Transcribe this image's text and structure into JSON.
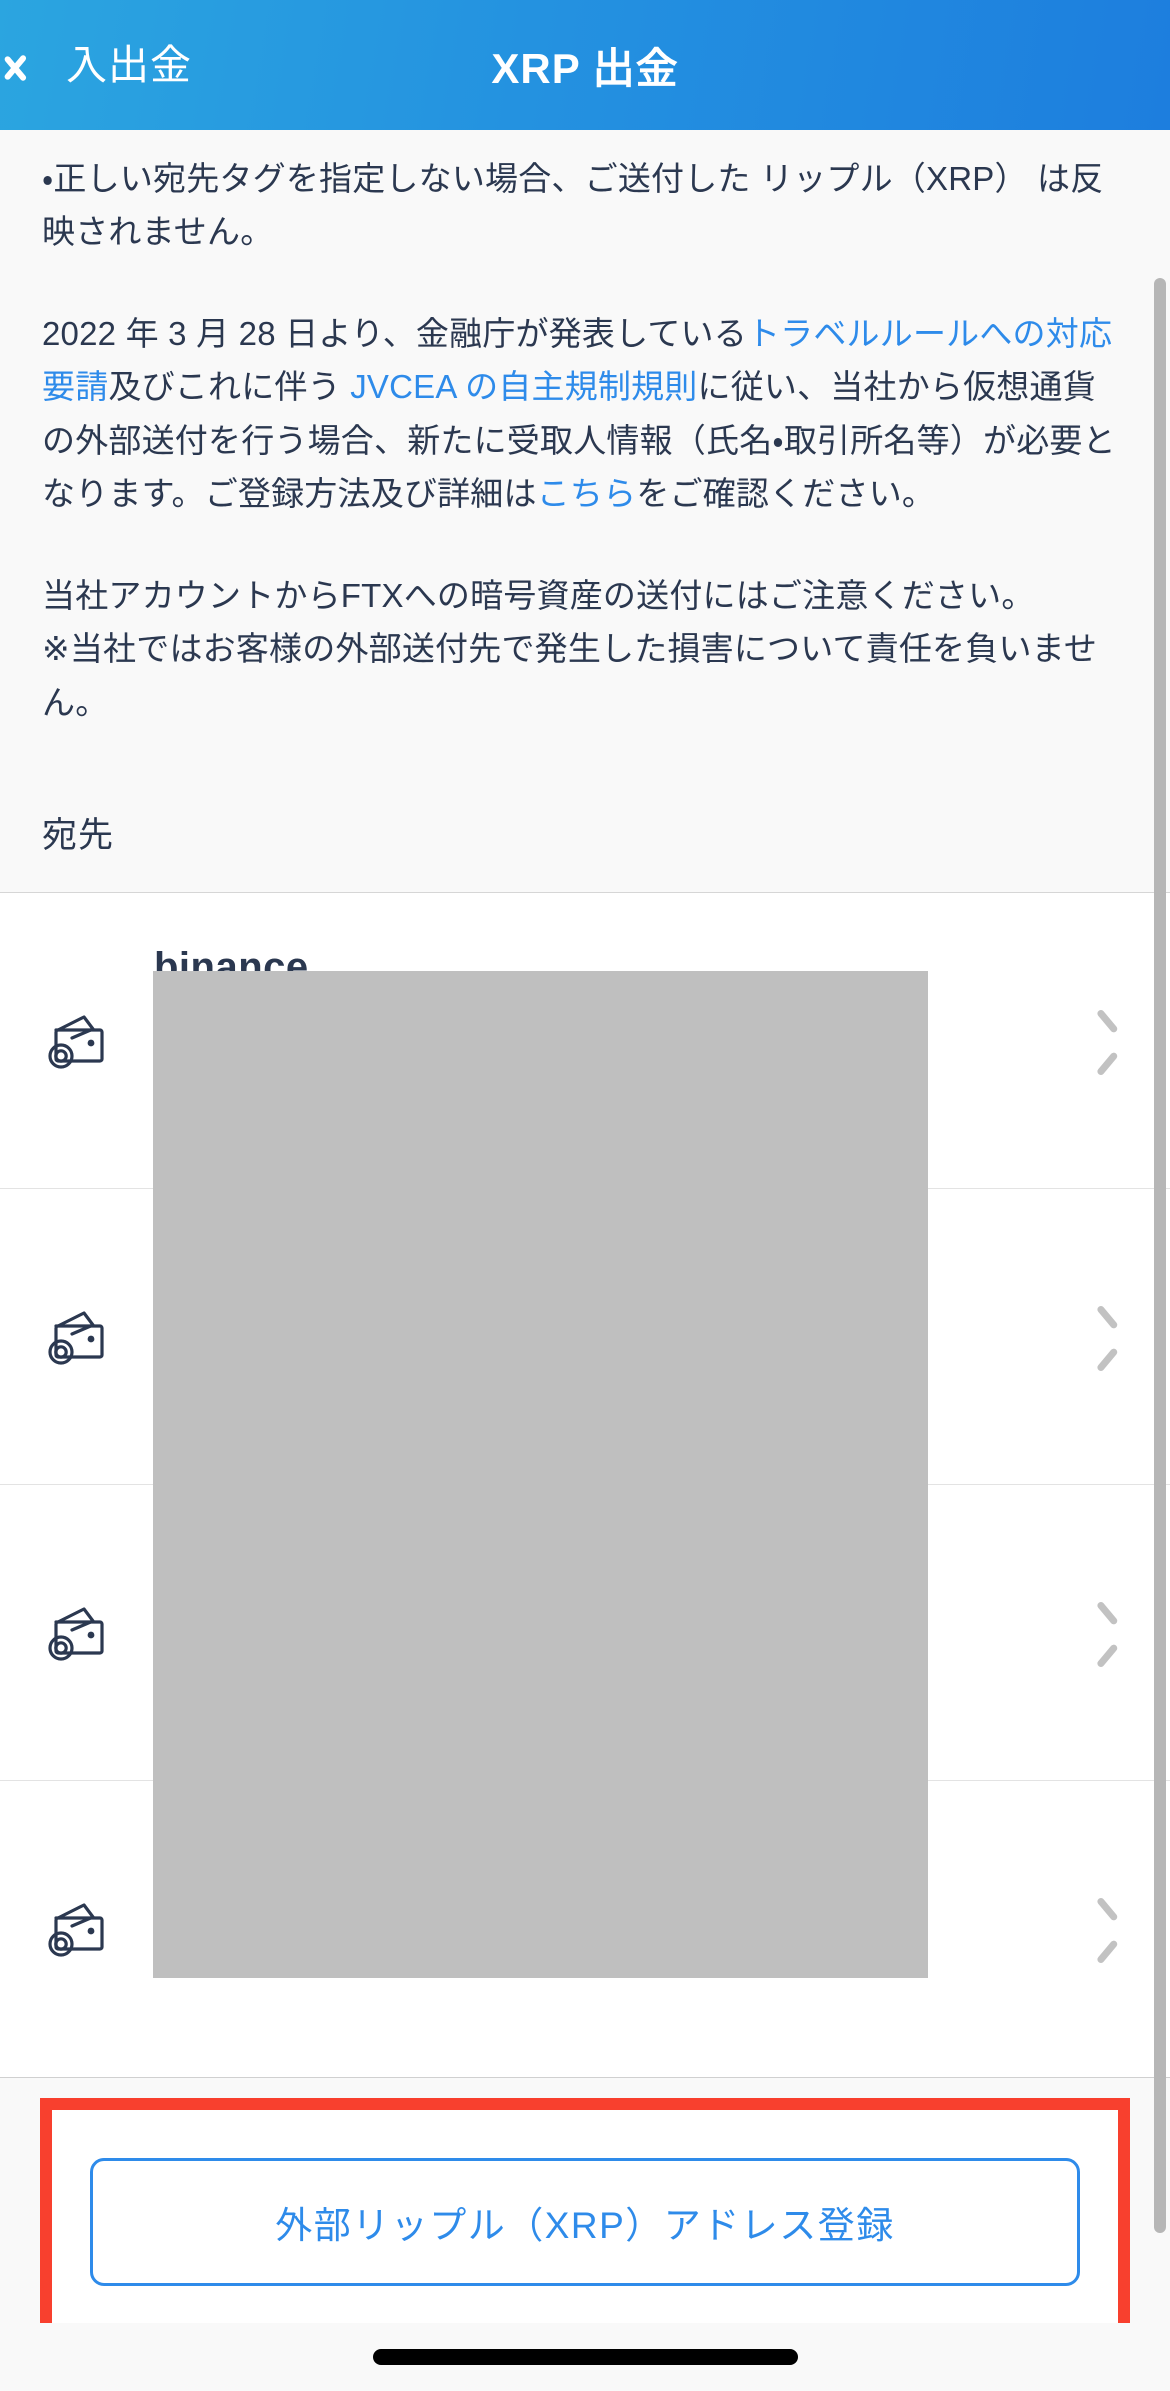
{
  "header": {
    "back_label": "入出金",
    "back_icon": "chevron-left-icon",
    "title": "XRP 出金",
    "bg_gradient_from": "#2ba5e0",
    "bg_gradient_to": "#1d7ede",
    "text_color": "#ffffff"
  },
  "notice": {
    "paragraph_1": "・正しい宛先タグを指定しない場合、ご送付した リップル（XRP） は反映されません。",
    "paragraph_2": {
      "part_1": "2022 年 3 月 28 日より、金融庁が発表している",
      "link_1": "トラベルルールへの対応要請",
      "part_2": "及びこれに伴う ",
      "link_2": "JVCEA の自主規制規則",
      "part_3": "に従い、当社から仮想通貨の外部送付を行う場合、新たに受取人情報（氏名・取引所名等）が必要となります。ご登録方法及び詳細は",
      "link_3": "こちら",
      "part_4": "をご確認ください。"
    },
    "paragraph_3_line_1": "当社アカウントからFTXへの暗号資産の送付にはご注意ください。",
    "paragraph_3_line_2": "※当社ではお客様の外部送付先で発生した損害について責任を負いません。",
    "link_color": "#2e8bea",
    "text_color": "#2b3850"
  },
  "destination_section": {
    "label": "宛先",
    "rows": [
      {
        "icon": "wallet-icon",
        "name": "binance",
        "chevron": "chevron-right-icon"
      },
      {
        "icon": "wallet-icon",
        "name": "",
        "chevron": "chevron-right-icon"
      },
      {
        "icon": "wallet-icon",
        "name": "",
        "chevron": "chevron-right-icon"
      },
      {
        "icon": "wallet-icon",
        "name": "",
        "chevron": "chevron-right-icon"
      }
    ],
    "redaction_color": "#bfbfbf"
  },
  "footer": {
    "highlight_color": "#f8402e",
    "register_button_label": "外部リップル（XRP）アドレス登録",
    "register_button_color": "#2e8bea"
  },
  "system": {
    "home_indicator": "home-indicator",
    "scrollbar_color": "#b6b6b6"
  }
}
